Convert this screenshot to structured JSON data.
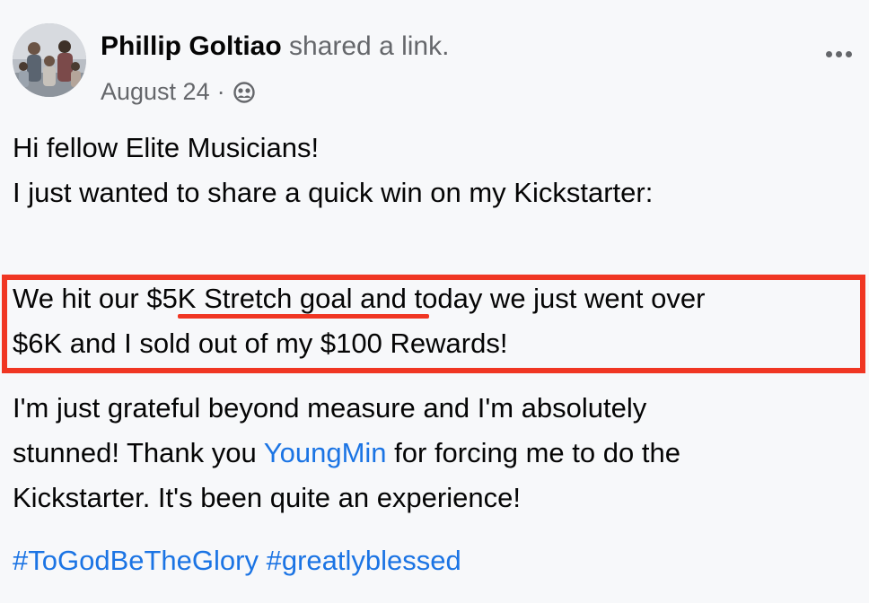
{
  "post": {
    "author_name": "Phillip Goltiao",
    "action_text": "shared a link.",
    "date": "August 24",
    "separator": "·",
    "audience_icon": "friends-icon",
    "more_icon": "more-options-icon",
    "lines": {
      "greeting": "Hi fellow Elite Musicians!",
      "intro": "I just wanted to share a quick win on my Kickstarter:",
      "highlight_prefix": "We hit our ",
      "highlight_underlined": "$5K Stretch goal",
      "highlight_suffix": " and today we just went over",
      "highlight_line2": "$6K and I sold out of my $100 Rewards!",
      "grateful": "I'm just grateful beyond measure and I'm absolutely",
      "thanks_prefix": "stunned! Thank you ",
      "mention": "YoungMin",
      "thanks_suffix": " for forcing me to do the",
      "closing": "Kickstarter. It's been quite an experience!"
    },
    "hashtags": [
      "#ToGodBeTheGlory",
      "#greatlyblessed"
    ]
  },
  "colors": {
    "link": "#1b74e4",
    "annotation_red": "#f03623",
    "secondary_text": "#65676b",
    "background": "#f7f8fa"
  }
}
